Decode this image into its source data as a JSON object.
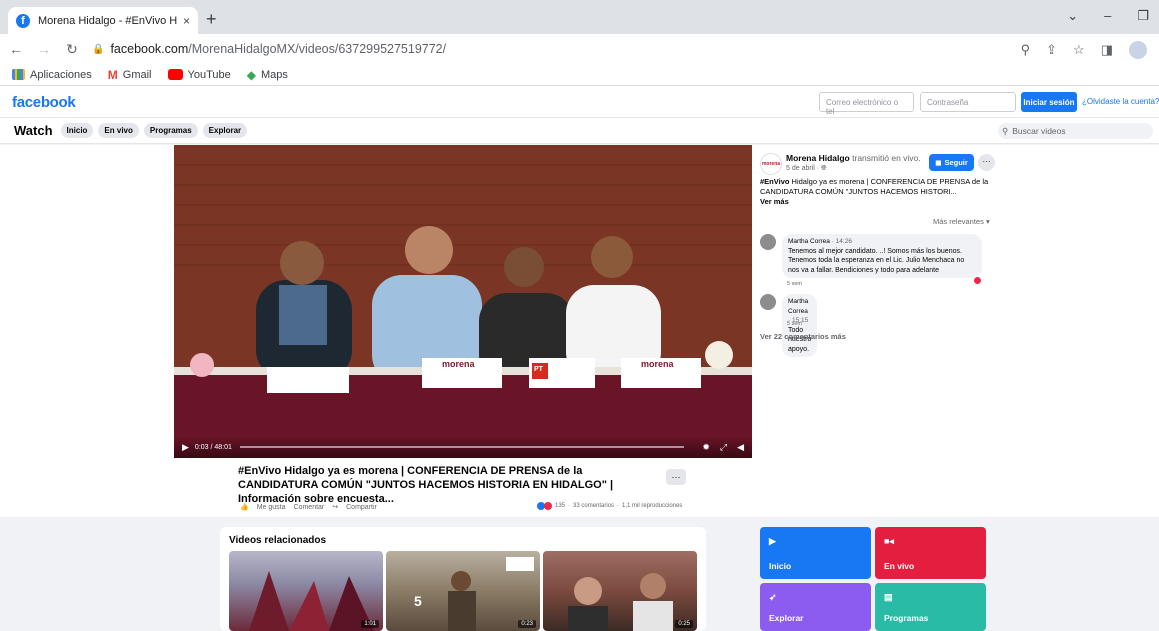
{
  "browser": {
    "tab_title": "Morena Hidalgo - #EnVivo Hidal",
    "tab_close": "×",
    "new_tab": "+",
    "url_domain": "facebook.com",
    "url_path": "/MorenaHidalgoMX/videos/637299527519772/",
    "bookmarks": [
      {
        "label": "Aplicaciones",
        "icon": "apps-grid-icon",
        "color": "#4285f4"
      },
      {
        "label": "Gmail",
        "icon": "gmail-icon",
        "color": "#ea4335"
      },
      {
        "label": "YouTube",
        "icon": "youtube-icon",
        "color": "#ff0000"
      },
      {
        "label": "Maps",
        "icon": "maps-icon",
        "color": "#34a853"
      }
    ]
  },
  "header": {
    "logo": "facebook",
    "email_placeholder": "Correo electrónico o tel",
    "password_placeholder": "Contraseña",
    "login_label": "Iniciar sesión",
    "forgot_label": "¿Olvidaste la cuenta?"
  },
  "watch_nav": {
    "title": "Watch",
    "pills": [
      "Inicio",
      "En vivo",
      "Programas",
      "Explorar"
    ],
    "search_placeholder": "Buscar videos"
  },
  "video": {
    "time": "0:03 / 48:01",
    "title": "#EnVivo Hidalgo ya es morena | CONFERENCIA DE PRENSA de la CANDIDATURA COMÚN \"JUNTOS HACEMOS HISTORIA EN HIDALGO\" | Información sobre encuesta...",
    "more": "···",
    "like_label": "Me gusta",
    "comment_label": "Comentar",
    "share_label": "Compartir",
    "reactions_count": "135",
    "comments_count": "33 comentarios",
    "views": "1,1 mil reproducciones",
    "sep": "·",
    "placards": [
      "morena",
      "morena",
      "PT"
    ]
  },
  "post": {
    "page_name": "Morena Hidalgo",
    "action": "transmitió en vivo.",
    "date": "5 de abril · ",
    "follow_label": "Seguir",
    "dots": "···",
    "text_bold": "#EnVivo",
    "text": " Hidalgo ya es morena | CONFERENCIA DE PRENSA de la CANDIDATURA COMÚN \"JUNTOS HACEMOS HISTORI...",
    "see_more": "Ver más",
    "sort_label": "Más relevantes"
  },
  "comments": [
    {
      "author": "Martha Correa",
      "time": " · 14:26",
      "text": "Tenemos al mejor candidato. ..! Somos más los buenos. Tenemos toda la esperanza en el Lic. Julio Menchaca no nos va a fallar. Bendiciones y todo para adelante",
      "ago": "5 sem"
    },
    {
      "author": "Martha Correa",
      "time": " · 15:15",
      "text": "Todo nuestro apoyo.",
      "ago": "5 sem"
    }
  ],
  "more_comments": "Ver 22 comentarios más",
  "related": {
    "title": "Videos relacionados",
    "items": [
      {
        "duration": "1:01"
      },
      {
        "duration": "0:23"
      },
      {
        "duration": "0:25"
      }
    ],
    "overlay_number": "5"
  },
  "tiles": [
    {
      "label": "Inicio",
      "color": "#1877f2",
      "icon": "play-icon"
    },
    {
      "label": "En vivo",
      "color": "#e41e3f",
      "icon": "live-camera-icon"
    },
    {
      "label": "Explorar",
      "color": "#8c5cf0",
      "icon": "rocket-icon"
    },
    {
      "label": "Programas",
      "color": "#2abba7",
      "icon": "clapper-icon"
    }
  ],
  "colors": {
    "facebook_blue": "#1877f2",
    "background": "#f0f2f5"
  }
}
